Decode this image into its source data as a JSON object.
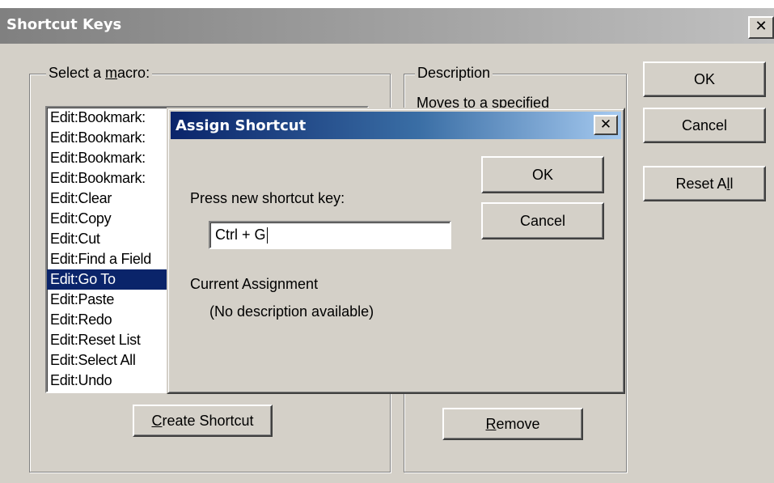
{
  "outer_dialog": {
    "title": "Shortcut Keys",
    "close_glyph": "✕",
    "macro_group": {
      "legend_prefix": "Select a ",
      "legend_underlined": "m",
      "legend_suffix": "acro:"
    },
    "macros": [
      "Edit:Bookmark:",
      "Edit:Bookmark:",
      "Edit:Bookmark:",
      "Edit:Bookmark:",
      "Edit:Clear",
      "Edit:Copy",
      "Edit:Cut",
      "Edit:Find a Field",
      "Edit:Go To",
      "Edit:Paste",
      "Edit:Redo",
      "Edit:Reset List",
      "Edit:Select All",
      "Edit:Undo"
    ],
    "selected_macro_index": 8,
    "description_group": {
      "legend": "Description",
      "text": "Moves to a specified"
    },
    "buttons": {
      "ok": "OK",
      "cancel": "Cancel",
      "reset_all_prefix": "Reset A",
      "reset_all_underlined": "l",
      "reset_all_suffix": "l",
      "create_shortcut_underlined": "C",
      "create_shortcut_suffix": "reate Shortcut",
      "remove_underlined": "R",
      "remove_suffix": "emove"
    }
  },
  "assign_dialog": {
    "title": "Assign Shortcut",
    "close_glyph": "✕",
    "prompt": "Press new shortcut key:",
    "shortcut_value": "Ctrl + G",
    "current_assignment_label": "Current Assignment",
    "current_assignment_value": "(No description available)",
    "buttons": {
      "ok": "OK",
      "cancel": "Cancel"
    }
  },
  "colors": {
    "face": "#d4d0c8",
    "selection": "#0a246a",
    "active_title_start": "#0a246a",
    "active_title_end": "#a6caf0",
    "inactive_title": "#808080"
  }
}
